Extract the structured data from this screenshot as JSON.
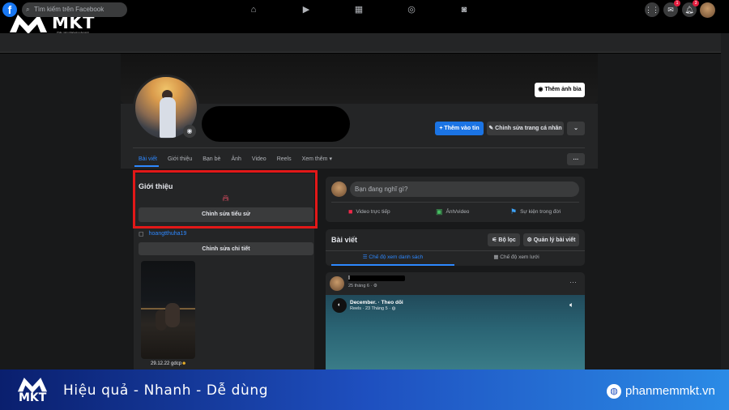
{
  "brand": {
    "name": "MKT",
    "tagline": "Phần mềm Marketing đa kênh"
  },
  "topbar": {
    "search_placeholder": "Tìm kiếm trên Facebook",
    "messenger_badge": "1",
    "notification_badge": "3"
  },
  "profile": {
    "cover_button": "Thêm ảnh bìa",
    "add_story": "Thêm vào tin",
    "edit_profile": "Chỉnh sửa trang cá nhân",
    "tabs": [
      "Bài viết",
      "Giới thiệu",
      "Bạn bè",
      "Ảnh",
      "Video",
      "Reels",
      "Xem thêm"
    ]
  },
  "intro": {
    "title": "Giới thiệu",
    "edit_bio": "Chỉnh sửa tiểu sử",
    "instagram": "hoangtthuha19",
    "edit_details": "Chỉnh sửa chi tiết",
    "photo_caption": "29.12.22 gdcp"
  },
  "composer": {
    "placeholder": "Bạn đang nghĩ gì?",
    "live": "Video trực tiếp",
    "photo": "Ảnh/video",
    "event": "Sự kiện trong đời"
  },
  "posts": {
    "title": "Bài viết",
    "filter": "Bộ lọc",
    "manage": "Quản lý bài viết",
    "list_view": "Chế độ xem danh sách",
    "grid_view": "Chế độ xem lưới"
  },
  "feed": {
    "name_initial": "I",
    "date": "25 tháng 6 · ",
    "video_title": "December. · Theo dõi",
    "video_sub": "Reels · 23 Tháng 5 · "
  },
  "banner": {
    "slogan": "Hiệu quả - Nhanh  - Dễ dùng",
    "url": "phanmemmkt.vn"
  }
}
